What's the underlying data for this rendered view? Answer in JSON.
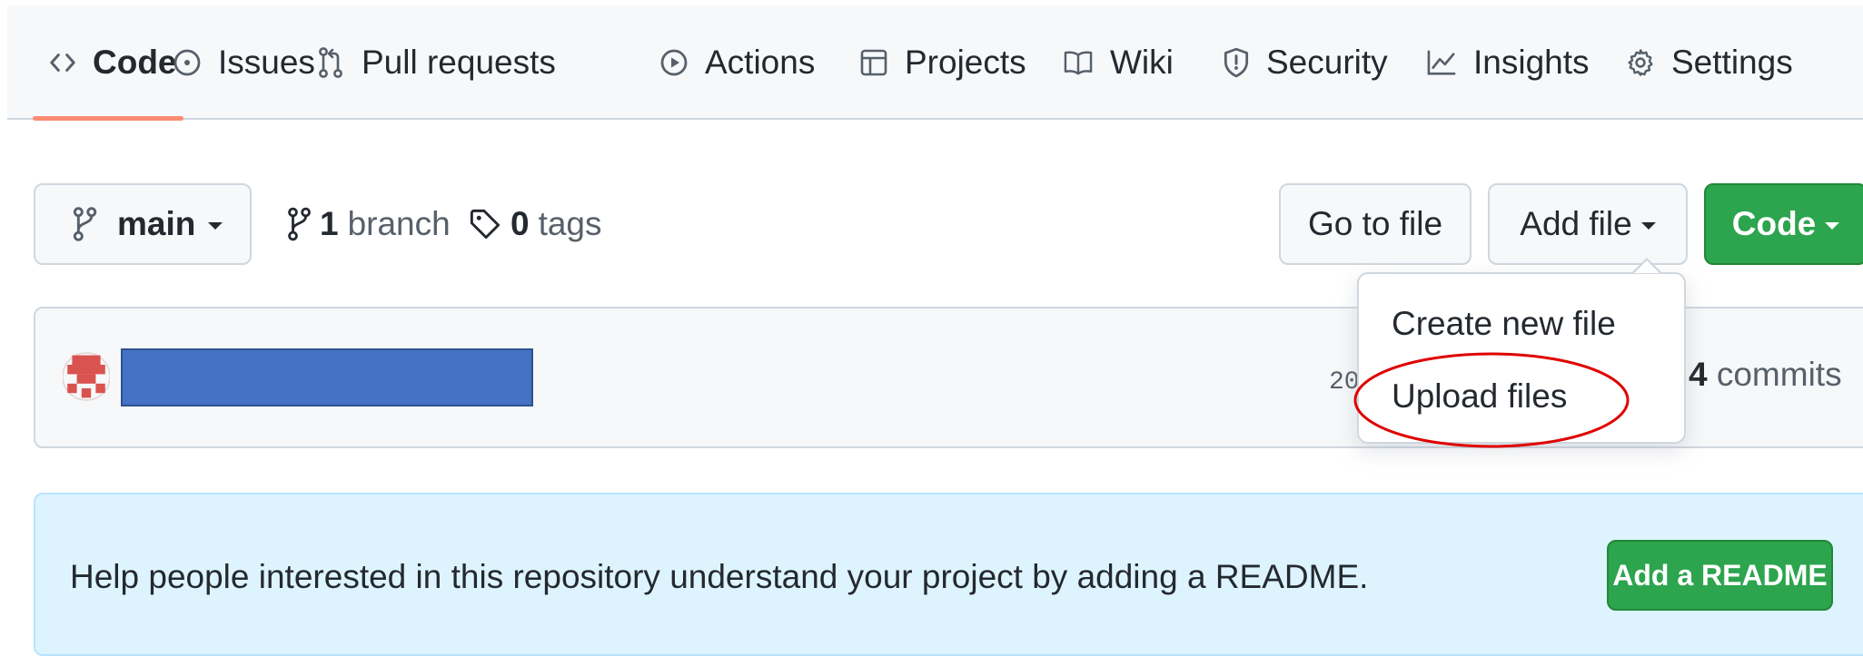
{
  "repo_nav": {
    "tabs": [
      {
        "label": "Code",
        "icon": "code-icon",
        "selected": true
      },
      {
        "label": "Issues",
        "icon": "issue-icon"
      },
      {
        "label": "Pull requests",
        "icon": "pull-request-icon"
      },
      {
        "label": "Actions",
        "icon": "play-icon"
      },
      {
        "label": "Projects",
        "icon": "table-icon"
      },
      {
        "label": "Wiki",
        "icon": "book-icon"
      },
      {
        "label": "Security",
        "icon": "shield-icon"
      },
      {
        "label": "Insights",
        "icon": "graph-icon"
      },
      {
        "label": "Settings",
        "icon": "gear-icon"
      }
    ]
  },
  "branch_bar": {
    "branch_name": "main",
    "branch_count": "1",
    "branch_word": "branch",
    "tag_count": "0",
    "tag_word": "tags",
    "go_to_file": "Go to file",
    "add_file": "Add file",
    "code": "Code"
  },
  "add_file_menu": {
    "items": [
      {
        "label": "Create new file"
      },
      {
        "label": "Upload files",
        "highlighted": true
      }
    ]
  },
  "commit": {
    "date_partial": "20",
    "commit_count": "4",
    "commit_word": "commits"
  },
  "readme": {
    "message": "Help people interested in this repository understand your project by adding a README.",
    "button": "Add a README"
  },
  "colors": {
    "accent_underline": "#fd8c73",
    "primary_green": "#2da44e",
    "banner_bg": "#ddf4ff",
    "redaction_blue": "#4472c4",
    "annotation_red": "#e00000"
  }
}
